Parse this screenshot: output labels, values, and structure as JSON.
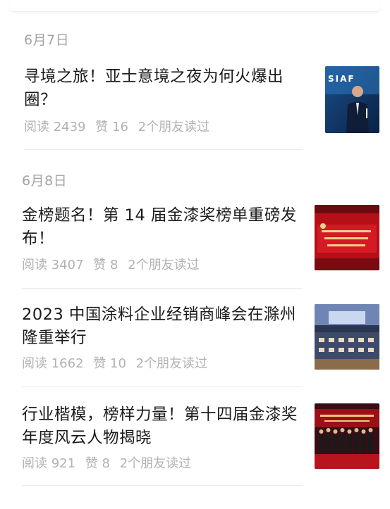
{
  "feed": {
    "groups": [
      {
        "date": "6月7日",
        "articles": [
          {
            "title": "寻境之旅！亚士意境之夜为何火爆出圈？",
            "reads": "阅读 2439",
            "likes": "赞 16",
            "friends": "2个朋友读过",
            "thumb_icon": "speaker-on-stage-photo",
            "thumb_text": "SIAF"
          }
        ]
      },
      {
        "date": "6月8日",
        "articles": [
          {
            "title": "金榜题名！第 14 届金漆奖榜单重磅发布！",
            "reads": "阅读 3407",
            "likes": "赞 8",
            "friends": "2个朋友读过",
            "thumb_icon": "award-ceremony-banner-photo"
          },
          {
            "title": "2023 中国涂料企业经销商峰会在滁州隆重举行",
            "reads": "阅读 1662",
            "likes": "赞 10",
            "friends": "2个朋友读过",
            "thumb_icon": "conference-hall-photo"
          },
          {
            "title": "行业楷模，榜样力量！第十四届金漆奖年度风云人物揭晓",
            "reads": "阅读 921",
            "likes": "赞 8",
            "friends": "2个朋友读过",
            "thumb_icon": "group-on-stage-photo"
          }
        ]
      }
    ]
  },
  "colors": {
    "title": "#1b1b1b",
    "meta": "#b2b2b2",
    "date": "#a3a3a3",
    "separator": "#e9e9e9",
    "banner_red": "#c8161e"
  }
}
